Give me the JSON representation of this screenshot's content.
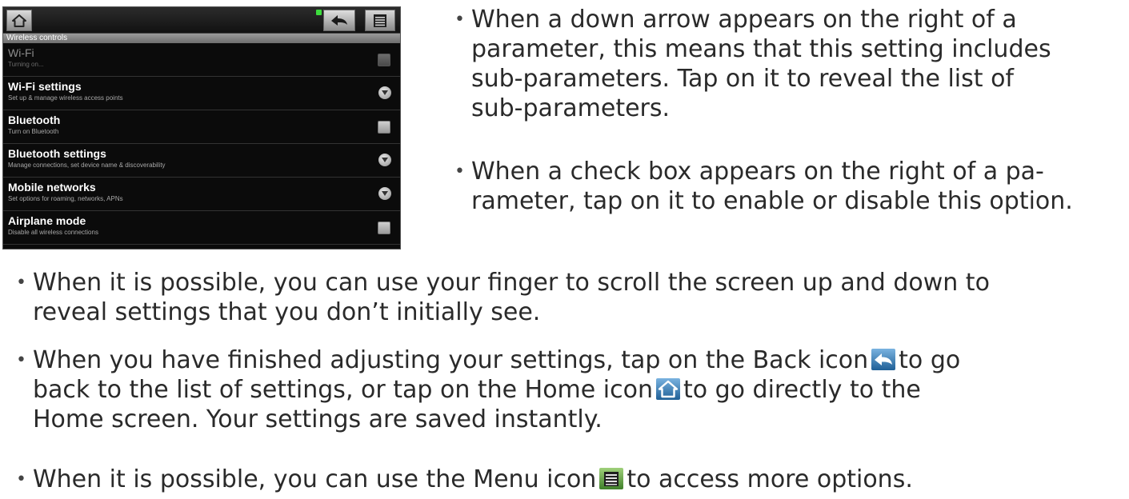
{
  "device": {
    "section_header": "Wireless controls",
    "icons": {
      "home": "home-icon",
      "back": "back-icon",
      "menu": "menu-icon",
      "signal": "signal-indicator-icon"
    },
    "settings": [
      {
        "title": "Wi-Fi",
        "subtitle": "Turning on...",
        "control": "checkbox",
        "state": "disabled"
      },
      {
        "title": "Wi-Fi settings",
        "subtitle": "Set up & manage wireless access points",
        "control": "arrow"
      },
      {
        "title": "Bluetooth",
        "subtitle": "Turn on Bluetooth",
        "control": "checkbox"
      },
      {
        "title": "Bluetooth settings",
        "subtitle": "Manage connections, set device name & discoverability",
        "control": "arrow"
      },
      {
        "title": "Mobile networks",
        "subtitle": "Set options for roaming, networks, APNs",
        "control": "arrow"
      },
      {
        "title": "Airplane mode",
        "subtitle": "Disable all wireless connections",
        "control": "checkbox"
      }
    ]
  },
  "bullets": {
    "b1": {
      "line1": "When a down arrow appears on the right of a",
      "line2": "parameter, this means that this setting includes",
      "line3": "sub-parameters. Tap on it to reveal the list of",
      "line4": "sub-parameters."
    },
    "b2": {
      "line1": "When a check box appears on the right of a pa-",
      "line2": "rameter, tap on it to enable or disable this option."
    },
    "b3": {
      "line1": "When it is possible, you can use your finger to scroll the screen up and down to",
      "line2": "reveal settings that you don’t initially see."
    },
    "b4": {
      "line1_a": "When you have finished adjusting your settings, tap on the Back icon",
      "line1_b": "to go",
      "line2_a": "back to the list of settings, or tap on the Home icon",
      "line2_b": "to go directly to the",
      "line3": "Home screen. Your settings are saved instantly."
    },
    "b5": {
      "line1_a": "When it is possible, you can use the Menu icon",
      "line1_b": "to access more options."
    },
    "bullet_char": "•"
  }
}
